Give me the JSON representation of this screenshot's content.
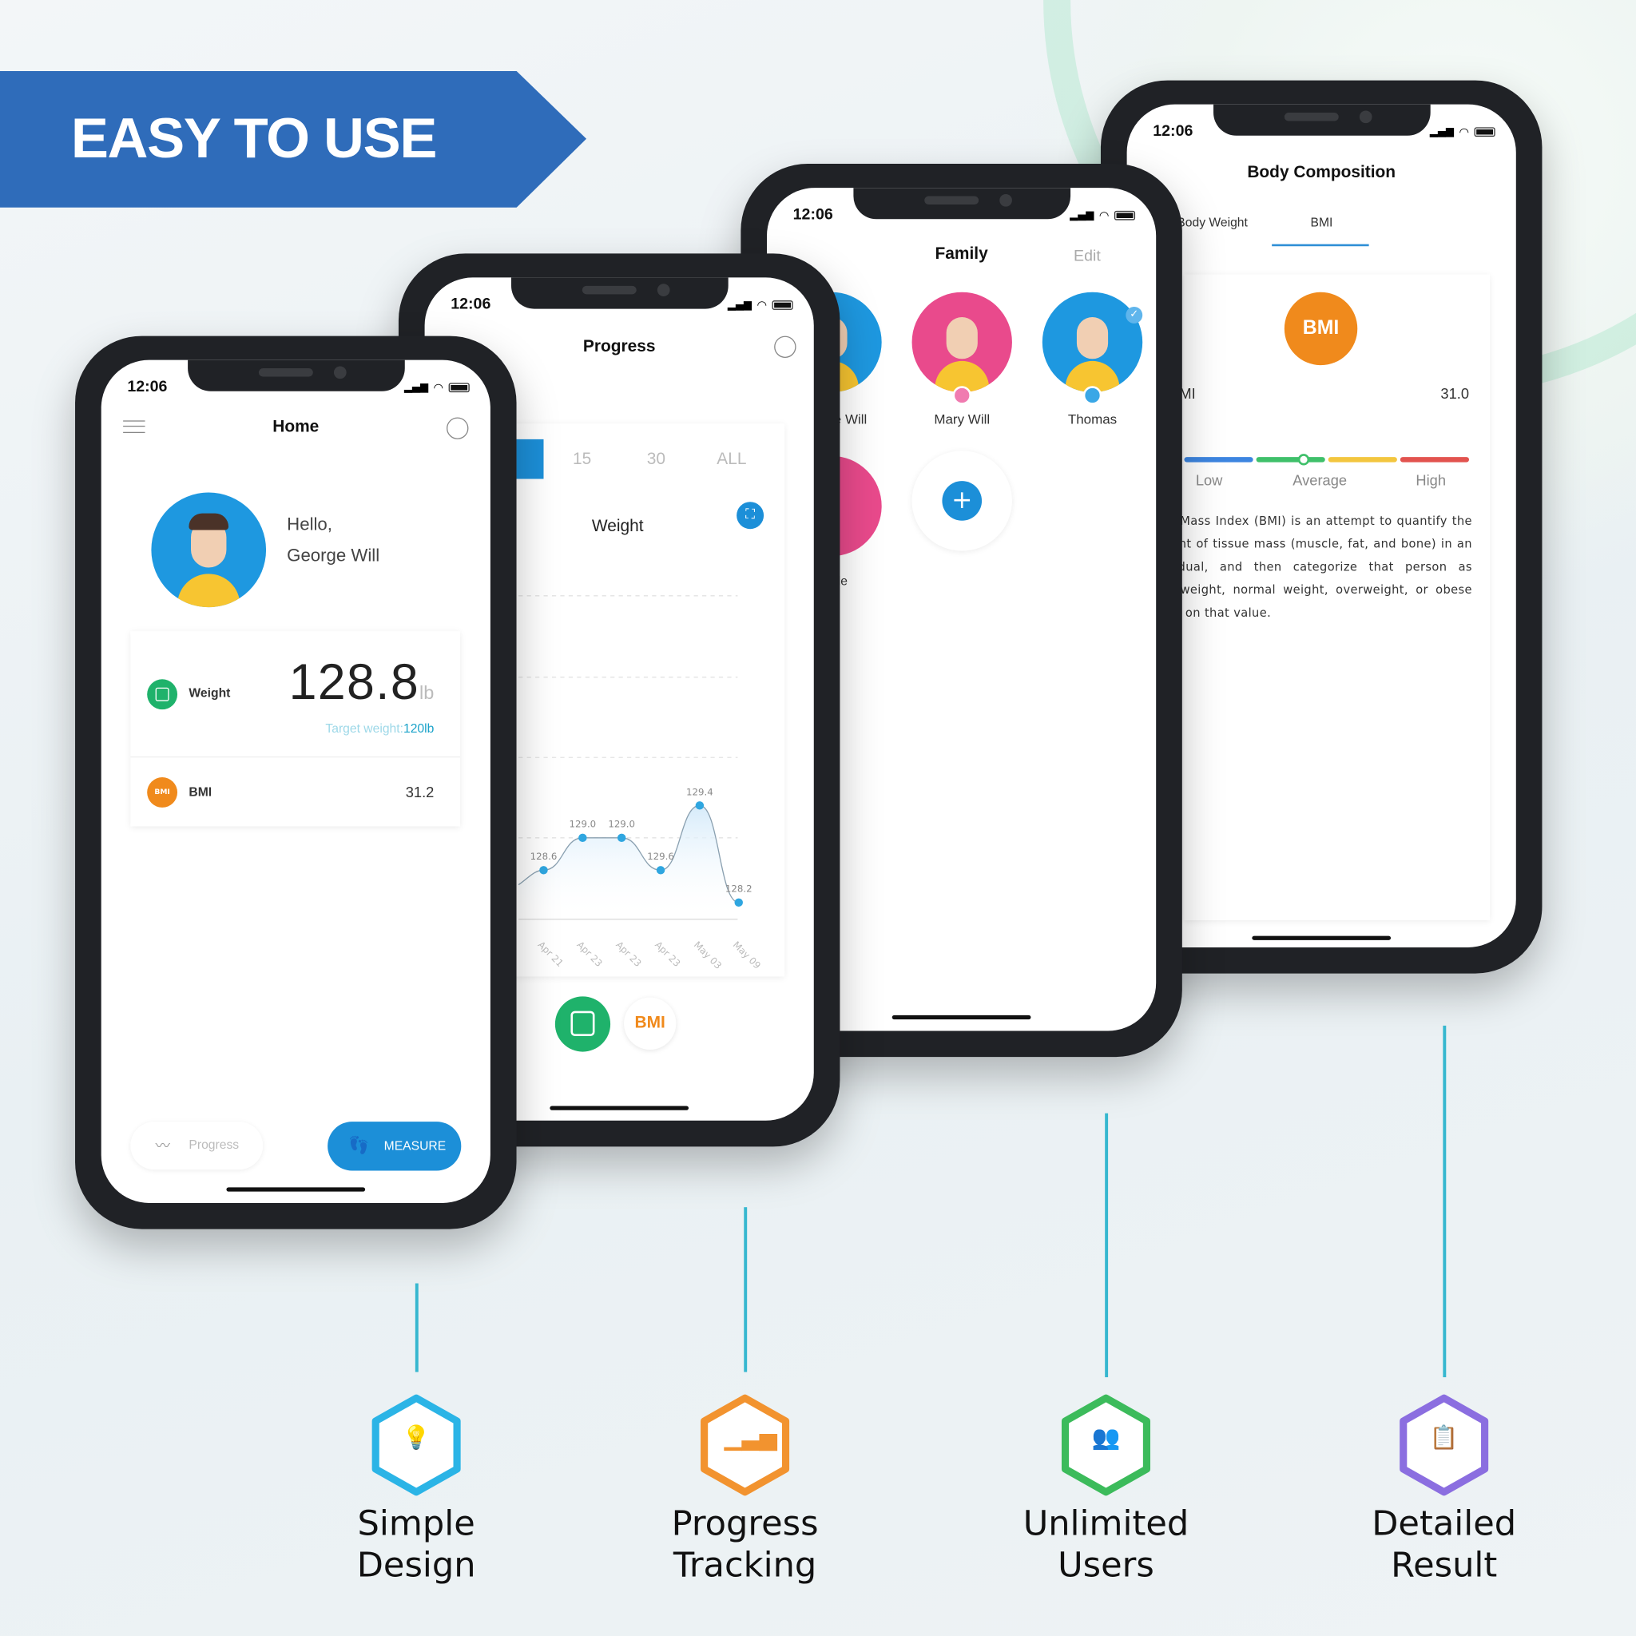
{
  "banner": {
    "title": "EASY TO USE"
  },
  "status_time": "12:06",
  "home": {
    "title": "Home",
    "greeting": "Hello,",
    "user_name": "George Will",
    "weight_label": "Weight",
    "weight_value": "128.8",
    "weight_unit": "lb",
    "target_prefix": "Target weight:",
    "target_value": "120lb",
    "bmi_label": "BMI",
    "bmi_icon_text": "BMI",
    "bmi_value": "31.2",
    "progress_button": "Progress",
    "measure_button": "MEASURE"
  },
  "progress": {
    "title": "Progress",
    "ranges": [
      "15",
      "30",
      "ALL"
    ],
    "metric_title": "Weight",
    "bmi_button": "BMI"
  },
  "chart_data": {
    "type": "line",
    "title": "Weight",
    "values": [
      128.6,
      129.0,
      129.0,
      128.6,
      129.4,
      128.2
    ],
    "point_labels": [
      "128.6",
      "129.0",
      "129.0",
      "129.6",
      "129.4",
      "128.2"
    ],
    "categories": [
      "Apr 21",
      "Apr 23",
      "Apr 23",
      "Apr 23",
      "May 03",
      "May 09"
    ],
    "grid": true,
    "series_color": "#2fa6e0"
  },
  "family": {
    "title": "Family",
    "edit": "Edit",
    "members": [
      {
        "name": "George Will",
        "gender": "male"
      },
      {
        "name": "Mary Will",
        "gender": "female"
      },
      {
        "name": "Thomas",
        "gender": "male",
        "selected": true
      }
    ],
    "partial_member_label": "le"
  },
  "body": {
    "title": "Body Composition",
    "tabs": [
      "Body Weight",
      "BMI"
    ],
    "active_tab": "BMI",
    "badge": "BMI",
    "row_label": "BMI",
    "row_value": "31.0",
    "scale_labels": [
      "Low",
      "Average",
      "High"
    ],
    "scale_colors": [
      "#3d85e0",
      "#3fc06a",
      "#f3c63f",
      "#e2534f"
    ],
    "description": "Body Mass Index (BMI) is an attempt to quantify the amount of tissue mass (muscle, fat, and bone) in an individual, and then categorize that person as underweight, normal weight, overweight, or obese based on that value."
  },
  "features": [
    {
      "line1": "Simple",
      "line2": "Design",
      "icon": "lightbulb-icon",
      "color": "#2bb4e6"
    },
    {
      "line1": "Progress",
      "line2": "Tracking",
      "icon": "bar-chart-icon",
      "color": "#f2932f"
    },
    {
      "line1": "Unlimited",
      "line2": "Users",
      "icon": "users-icon",
      "color": "#3cbb5b"
    },
    {
      "line1": "Detailed",
      "line2": "Result",
      "icon": "clipboard-check-icon",
      "color": "#8b6ee0"
    }
  ]
}
